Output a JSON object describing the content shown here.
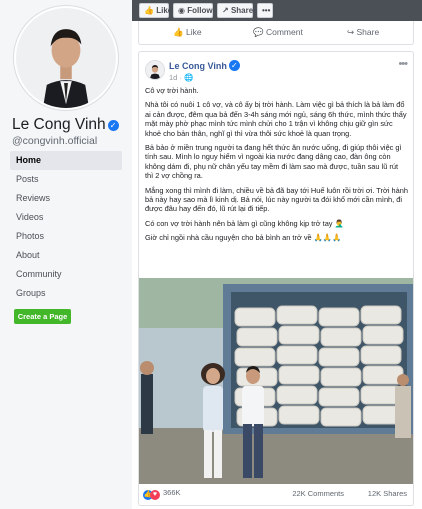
{
  "sidebar": {
    "name": "Le Cong Vinh",
    "username": "@congvinh.official",
    "nav": [
      "Home",
      "Posts",
      "Reviews",
      "Videos",
      "Photos",
      "About",
      "Community",
      "Groups"
    ],
    "create_page": "Create a Page"
  },
  "topbar": {
    "like": "Like",
    "follow": "Follow",
    "share": "Share",
    "more": "•••"
  },
  "prev_actions": {
    "like": "Like",
    "comment": "Comment",
    "share": "Share"
  },
  "post": {
    "author": "Le Cong Vinh",
    "time": "1d",
    "paragraphs": [
      "Cô vợ trời hành.",
      "Nhà tôi có nuôi 1 cô vợ, và cô ấy bị trời hành. Làm việc gì bả thích là bả làm đổ ai cản được, đêm qua bả đến 3-4h sáng mới ngủ, sáng 6h thức, mình thức thấy mặt mày phờ phạc mình tức mình chửi cho 1 trận vì không chịu giữ gìn sức khoẻ cho bản thân, nghĩ gì thì vừa thôi sức khoẻ là quan trọng.",
      "Bả bảo ở miền trung người ta đang hết thức ăn nước uống, đi giúp thôi việc gì tính sau. Mình lo nguy hiểm vì ngoài kia nước đang dâng cao, đàn ông còn không dám đi, phụ nữ chân yếu tay mềm đi làm sao mà được, tuần sau lũ rút thì 2 vợ chồng ra.",
      "Mắng xong thì mình đi làm, chiều về bả đã bay tới Huế luôn rồi trời ơi. Trời hành bả này hay sao mà lì kinh dị. Bả nói, lúc này người ta đói khổ mới cần mình, đi được đâu hay đến đó, lũ rút lại đi tiếp.",
      "Có con vợ trời hành nên bả làm gì cũng không kịp trở tay 🤦‍♂️",
      "Giờ chỉ ngồi nhà cầu nguyện cho bả bình an trở về 🙏🙏🙏"
    ],
    "reactions": "366K",
    "comments": "22K Comments",
    "shares": "12K Shares"
  }
}
